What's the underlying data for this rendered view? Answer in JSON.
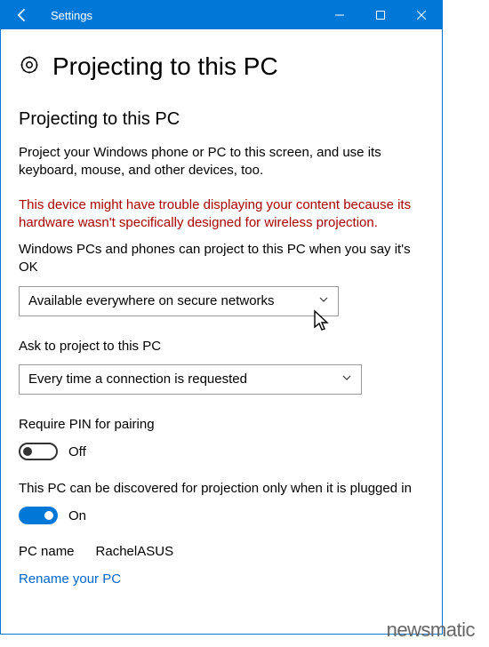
{
  "titlebar": {
    "app_title": "Settings"
  },
  "header": {
    "page_title": "Projecting to this PC"
  },
  "section": {
    "title": "Projecting to this PC",
    "description": "Project your Windows phone or PC to this screen, and use its keyboard, mouse, and other devices, too.",
    "warning": "This device might have trouble displaying your content because its hardware wasn't specifically designed for wireless projection."
  },
  "settings": {
    "projection_label": "Windows PCs and phones can project to this PC when you say it's OK",
    "projection_value": "Available everywhere on secure networks",
    "ask_label": "Ask to project to this PC",
    "ask_value": "Every time a connection is requested",
    "pin_label": "Require PIN for pairing",
    "pin_state": "Off",
    "discover_label": "This PC can be discovered for projection only when it is plugged in",
    "discover_state": "On",
    "pc_name_label": "PC name",
    "pc_name_value": "RachelASUS",
    "rename_link": "Rename your PC"
  },
  "watermark": "newsmatic"
}
